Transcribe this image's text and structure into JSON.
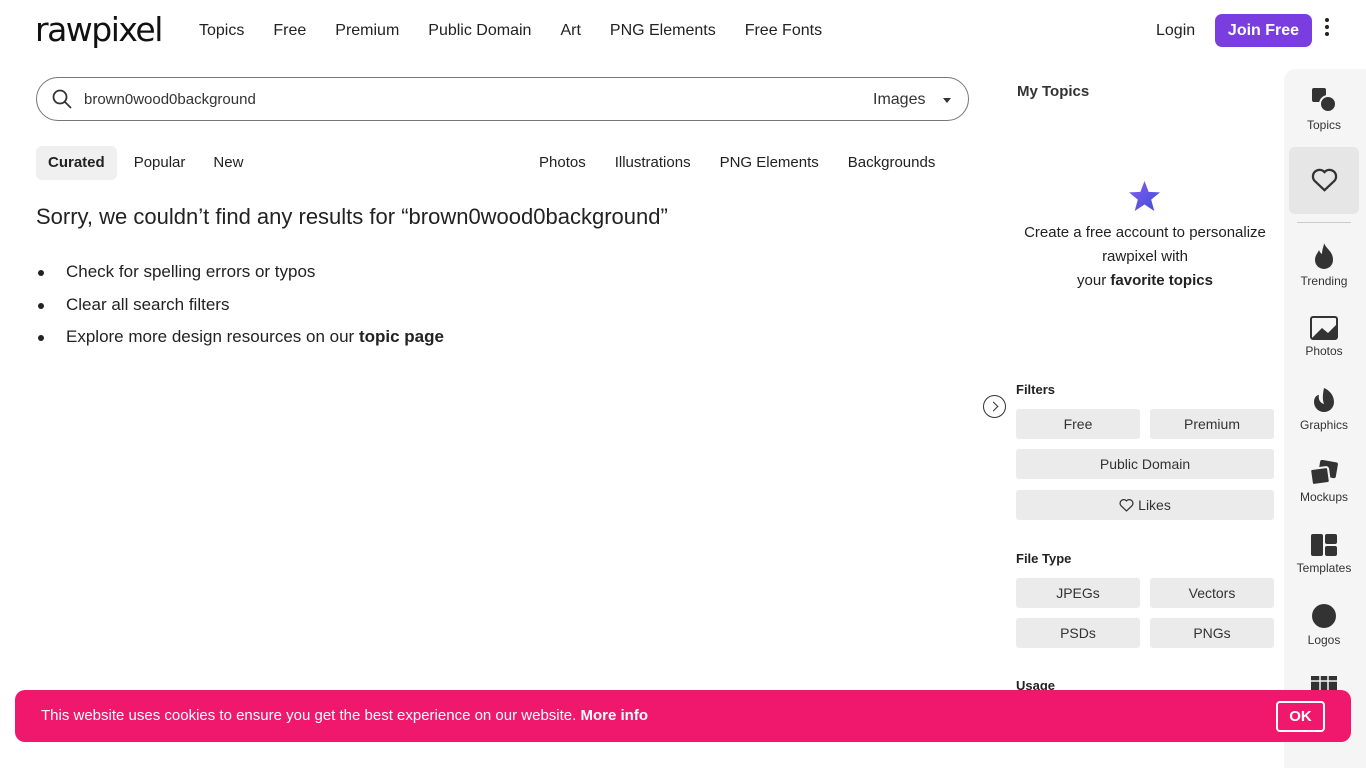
{
  "brand": {
    "logo_text": "rawpixel",
    "accent_color": "#7a3ee0",
    "cookie_color": "#f0186c"
  },
  "header": {
    "nav": [
      "Topics",
      "Free",
      "Premium",
      "Public Domain",
      "Art",
      "PNG Elements",
      "Free Fonts"
    ],
    "login_label": "Login",
    "join_label": "Join Free"
  },
  "search": {
    "query": "brown0wood0background",
    "type_selected": "Images"
  },
  "sort_tabs": [
    "Curated",
    "Popular",
    "New"
  ],
  "sort_active": "Curated",
  "category_links": [
    "Photos",
    "Illustrations",
    "PNG Elements",
    "Backgrounds"
  ],
  "results": {
    "sorry_message": "Sorry, we couldn’t find any results for “brown0wood0background”",
    "tips": {
      "tip1": "Check for spelling errors or typos",
      "tip2": "Clear all search filters",
      "tip3_prefix": "Explore more design resources on our ",
      "tip3_link": "topic page"
    }
  },
  "my_topics": {
    "title": "My Topics",
    "promo_line1": "Create a free account to personalize rawpixel with",
    "promo_prefix": "your ",
    "promo_bold": "favorite topics"
  },
  "filters": {
    "title": "Filters",
    "free": "Free",
    "premium": "Premium",
    "public_domain": "Public Domain",
    "likes": "Likes"
  },
  "file_type": {
    "title": "File Type",
    "jpegs": "JPEGs",
    "vectors": "Vectors",
    "psds": "PSDs",
    "pngs": "PNGs"
  },
  "usage": {
    "title": "Usage"
  },
  "rail": {
    "topics": "Topics",
    "trending": "Trending",
    "photos": "Photos",
    "graphics": "Graphics",
    "mockups": "Mockups",
    "templates": "Templates",
    "logos": "Logos"
  },
  "cookie": {
    "message": "This website uses cookies to ensure you get the best experience on our website.",
    "more_info": "More info",
    "ok_label": "OK"
  }
}
